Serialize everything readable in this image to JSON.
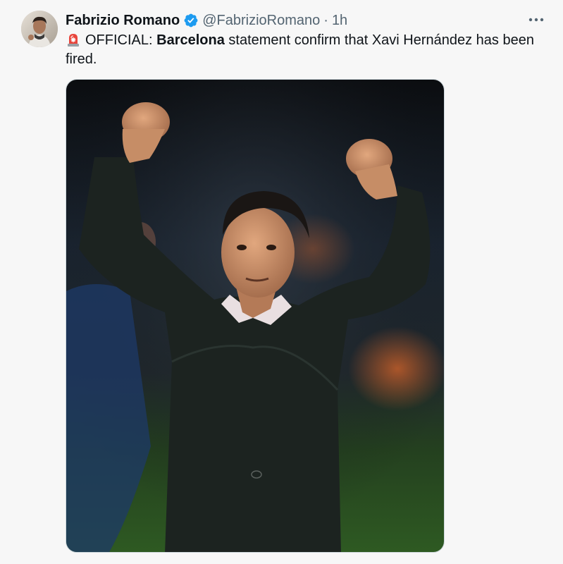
{
  "tweet": {
    "display_name": "Fabrizio Romano",
    "handle": "@FabrizioRomano",
    "separator": "·",
    "time": "1h",
    "text_prefix": "OFFICIAL: ",
    "text_bold": "Barcelona",
    "text_suffix": " statement confirm that Xavi Hernández has been fired.",
    "icons": {
      "avatar": "avatar",
      "verified": "verified-badge-icon",
      "siren": "siren-emoji-icon",
      "more": "more-options-icon"
    },
    "colors": {
      "verified": "#1d9bf0",
      "secondary_text": "#536471",
      "primary_text": "#0f1419"
    }
  }
}
